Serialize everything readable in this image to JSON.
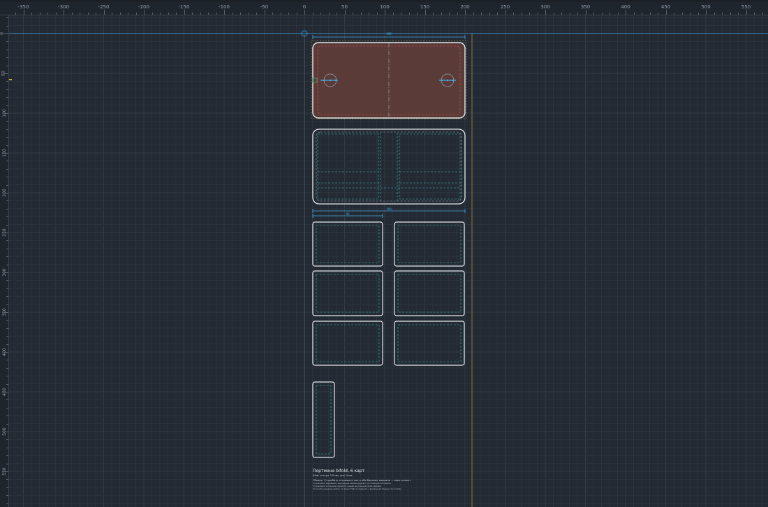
{
  "app": {
    "units_label": "мм",
    "colors": {
      "background": "#232a33",
      "grid_minor": "#2b333d",
      "grid_major": "#323b46",
      "outline": "#e8ebef",
      "stitch": "#39b6b0",
      "dimension": "#4aa8e0",
      "origin_axis": "#3d8ec4",
      "sheet_edge": "#c9a640",
      "fold_line": "#9aa3ad",
      "highlight_fill": "#5a3b38",
      "highlight_stitch": "#d4544f"
    }
  },
  "ruler": {
    "x_labels": [
      "-350",
      "-300",
      "-250",
      "-200",
      "-150",
      "-100",
      "-50",
      "0",
      "50",
      "100",
      "150",
      "200",
      "250",
      "300",
      "350",
      "400",
      "450",
      "500",
      "550"
    ],
    "y_labels": [
      "0",
      "50",
      "100",
      "150",
      "200",
      "250",
      "300",
      "350",
      "400",
      "450",
      "500",
      "550"
    ]
  },
  "drawing": {
    "dim_top": "190",
    "dim_middle": "190",
    "dim_small": "90",
    "parts": [
      {
        "name": "outer-shell",
        "selected": true,
        "holes": 2
      },
      {
        "name": "inner-panel"
      },
      {
        "name": "card-slot"
      },
      {
        "name": "card-slot"
      },
      {
        "name": "card-slot"
      },
      {
        "name": "card-slot"
      },
      {
        "name": "card-slot"
      },
      {
        "name": "card-slot"
      },
      {
        "name": "strap"
      }
    ]
  },
  "notes": {
    "title": "Портмоне bifold, 6 карт",
    "line1": "Шов: отступ 3.5 мм, шаг 4 мм",
    "line2": "Сборка: 1) пробить и прошить низ и оба боковых кармана — верх открыт",
    "line3": "2) приклеить кармашки к внутренней панели внахлёст (по отметкам на панели)",
    "line4": "3) приклеить и прошить периметр: панели внутренние кроме кармана",
    "line5": "4) склеить внешнюю деталь по линии сгиба и соединить с внутренней панелью по контуру"
  }
}
